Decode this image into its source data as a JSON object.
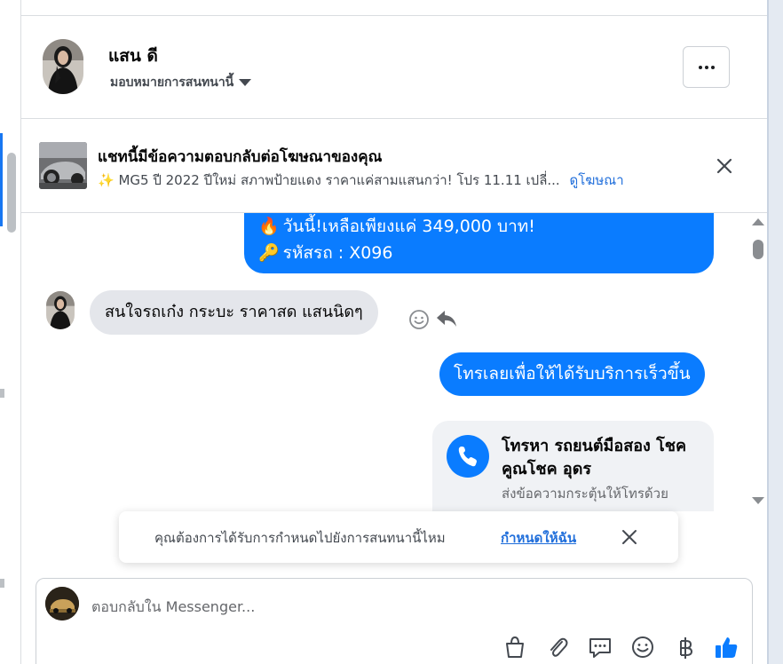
{
  "contact": {
    "name": "แสน ดี",
    "assign_label": "มอบหมายการสนทนานี้"
  },
  "ad_banner": {
    "title": "แชทนี้มีข้อความตอบกลับต่อโฆษณาของคุณ",
    "sparkle": "✨",
    "preview": "MG5 ปี 2022 ปีใหม่ สภาพป้ายแดง ราคาแค่สามแสนกว่า! โปร 11.11 เปลี่...",
    "link": "ดูโฆษณา"
  },
  "messages": {
    "top_line1_emoji": "🔥",
    "top_line1": "วันนี้!เหลือเพียงแค่ 349,000 บาท!",
    "top_line2_emoji": "🔑",
    "top_line2": "รหัสรถ : X096",
    "incoming": "สนใจรถเก๋ง กระบะ ราคาสด แสนนิดๆ",
    "outgoing": "โทรเลยเพื่อให้ได้รับบริการเร็วขึ้น",
    "call_card": {
      "title": "โทรหา รถยนต์มือสอง โชคคูณโชค อุดร",
      "subtitle": "ส่งข้อความกระตุ้นให้โทรด้วย"
    }
  },
  "toast": {
    "text": "คุณต้องการได้รับการกำหนดไปยังการสนทนานี้ไหม",
    "link": "กำหนดให้ฉัน"
  },
  "composer": {
    "placeholder": "ตอบกลับใน Messenger...",
    "tools": [
      "shopping-bag-icon",
      "paperclip-icon",
      "chat-bubble-icon",
      "emoji-icon",
      "baht-icon",
      "thumbs-up-icon"
    ]
  },
  "colors": {
    "outgoing_bubble": "#0a7cff",
    "incoming_bubble": "#e4e6eb",
    "link": "#216fdb",
    "like": "#0a7cff"
  }
}
